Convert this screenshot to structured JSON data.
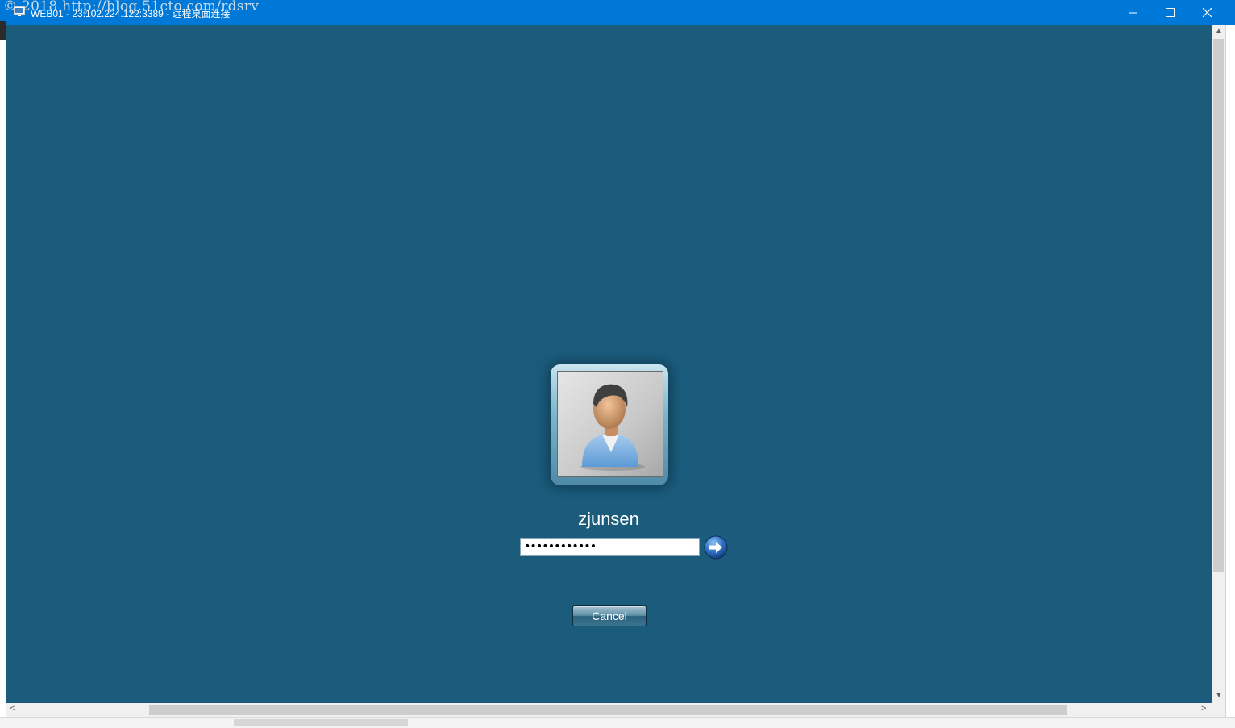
{
  "window": {
    "title": "WEB01 - 23.102.224.122:3389 - 远程桌面连接",
    "watermark": "© 2018 http://blog.51cto.com/rdsrv",
    "titlebar_color": "#0078d7"
  },
  "titlebar_buttons": {
    "minimize_icon": "minimize-icon",
    "maximize_icon": "maximize-icon",
    "close_icon": "close-icon"
  },
  "session": {
    "background_color": "#1b5c7c"
  },
  "login": {
    "user_name": "zjunsen",
    "password_mask": "••••••••••••",
    "submit_icon": "arrow-right-icon",
    "cancel_label": "Cancel"
  },
  "scrollbars": {
    "up_arrow": "▲",
    "down_arrow": "▼",
    "left_arrow": "<",
    "right_arrow": ">"
  }
}
